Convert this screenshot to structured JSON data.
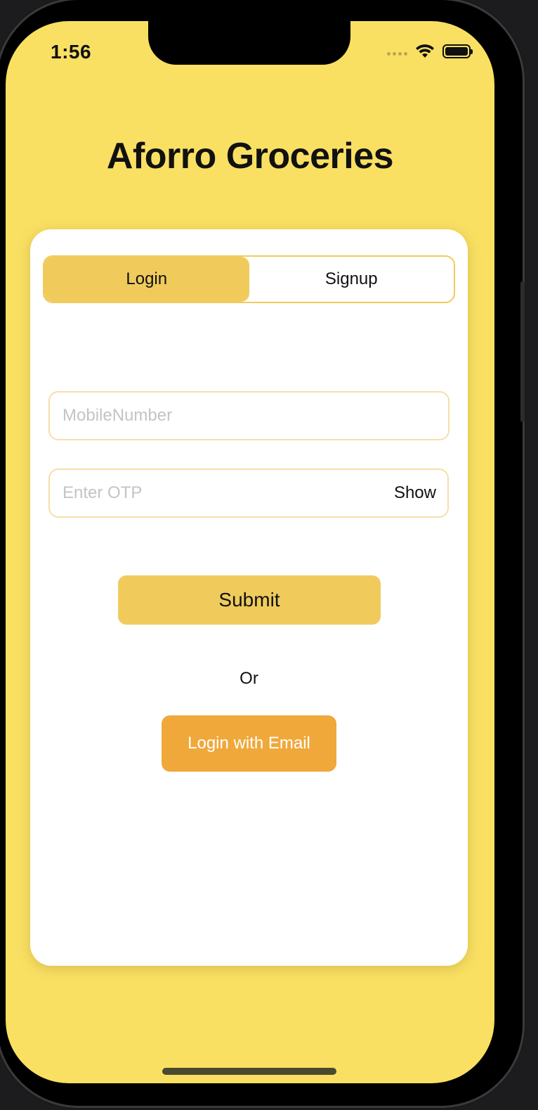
{
  "status_bar": {
    "time": "1:56",
    "icons": [
      "cellular-signal-icon",
      "wifi-icon",
      "battery-icon"
    ]
  },
  "app": {
    "title": "Aforro Groceries"
  },
  "tabs": [
    {
      "label": "Login",
      "active": true
    },
    {
      "label": "Signup",
      "active": false
    }
  ],
  "form": {
    "mobile": {
      "placeholder": "MobileNumber",
      "value": ""
    },
    "otp": {
      "placeholder": "Enter OTP",
      "value": "",
      "toggle_label": "Show"
    },
    "submit_label": "Submit",
    "divider_text": "Or",
    "email_login_label": "Login with Email"
  },
  "colors": {
    "background": "#f9e063",
    "accent": "#f0cb5c",
    "email_button": "#f0a83b",
    "card": "#ffffff"
  }
}
